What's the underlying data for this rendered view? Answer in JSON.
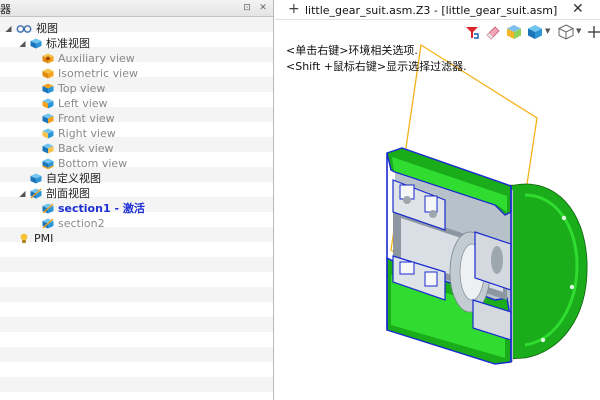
{
  "left_panel": {
    "title": "器",
    "header_buttons": [
      "⊡",
      "✕"
    ],
    "tree": {
      "root": "视图",
      "standard_views": {
        "label": "标准视图",
        "items": [
          "Auxiliary view",
          "Isometric view",
          "Top view",
          "Left view",
          "Front view",
          "Right view",
          "Back view",
          "Bottom view"
        ]
      },
      "custom_view": "自定义视图",
      "section_views": {
        "label": "剖面视图",
        "active_name": "section1",
        "active_suffix": " - 激活",
        "inactive_name": "section2"
      },
      "pmi": "PMI"
    }
  },
  "tab": {
    "plus": "+",
    "title": "little_gear_suit.asm.Z3 - [little_gear_suit.asm]",
    "close": "✕"
  },
  "toolbar": {
    "icons": [
      "filter-icon",
      "eraser-icon",
      "shade-icon",
      "view-cube-icon",
      "wireframe-cube-icon",
      "cross-icon"
    ]
  },
  "hints": {
    "line1": "<单击右键>环境相关选项.",
    "line2": "<Shift +鼠标右键>显示选择过滤器."
  },
  "colors": {
    "model_green": "#1aac1a",
    "model_bright": "#2fdc2f",
    "edge_blue": "#1a2ad0",
    "section_plane": "#f5b21a",
    "active_text": "#1f2fd6"
  }
}
